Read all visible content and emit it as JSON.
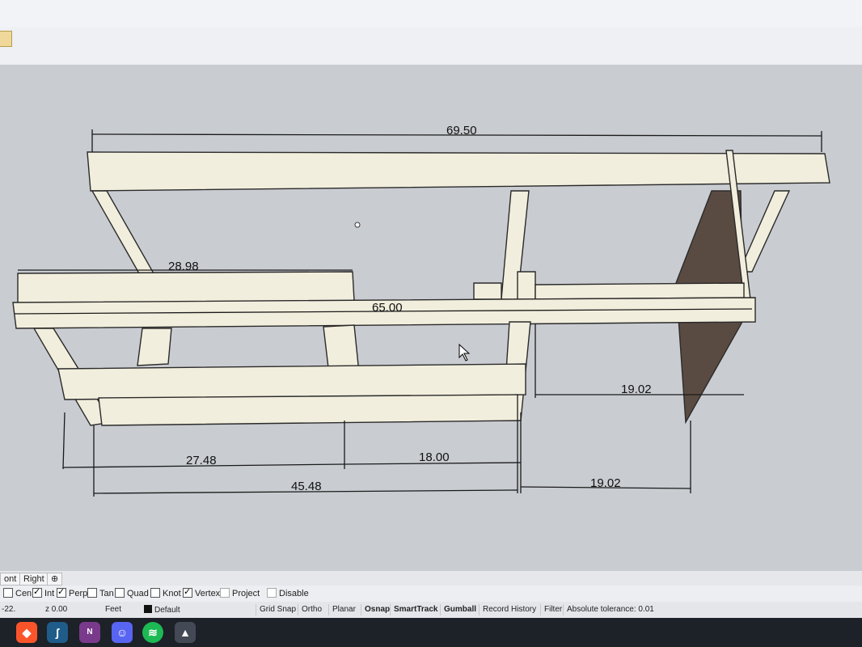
{
  "window": {
    "title": ""
  },
  "viewport": {
    "dimensions": {
      "top_total": "69.50",
      "left_board": "28.98",
      "middle_rail": "65.00",
      "right_inner": "19.02",
      "bottom_left": "27.48",
      "bottom_mid": "18.00",
      "bottom_total": "45.48",
      "bottom_right": "19.02"
    }
  },
  "view_tabs": {
    "front": "ont",
    "right": "Right",
    "add": "⊕"
  },
  "osnap": {
    "cen": "Cen",
    "int": "Int",
    "perp": "Perp",
    "tan": "Tan",
    "quad": "Quad",
    "knot": "Knot",
    "vertex": "Vertex",
    "project": "Project",
    "disable": "Disable"
  },
  "status": {
    "x": "-22.",
    "z": "z 0.00",
    "units": "Feet",
    "layer": "Default",
    "grid_snap": "Grid Snap",
    "ortho": "Ortho",
    "planar": "Planar",
    "osnap": "Osnap",
    "smarttrack": "SmartTrack",
    "gumball": "Gumball",
    "record_history": "Record History",
    "filter": "Filter",
    "tolerance": "Absolute tolerance: 0.01"
  },
  "taskbar": {
    "icons": [
      "brave-icon",
      "sketchup-icon",
      "onenote-icon",
      "discord-icon",
      "spotify-icon",
      "rhino-icon"
    ],
    "colors": {
      "brave": "#fb542b",
      "sketchup": "#1f5c8a",
      "onenote": "#7a3a8c",
      "discord": "#5865f2",
      "spotify": "#1db954",
      "rhino": "#444a55"
    }
  }
}
